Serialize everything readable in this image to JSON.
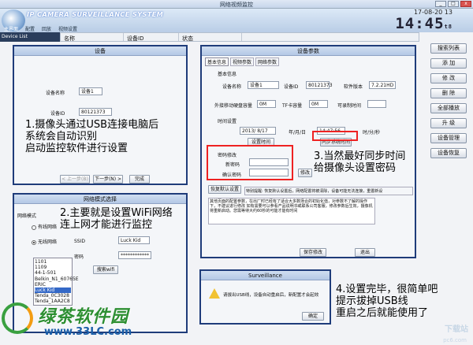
{
  "window": {
    "title": "网络视频监控"
  },
  "header": {
    "system_name": "IP CAMERA SURVEILLANCE SYSTEM",
    "date": "17-08-20 13",
    "time": "14:45",
    "time_suffix": "t8"
  },
  "tabs": [
    "主界面",
    "配置",
    "回放",
    "视频设置"
  ],
  "device_list": {
    "label": "Device List"
  },
  "columns": [
    "名称",
    "设备ID",
    "状态"
  ],
  "right_buttons": [
    "搜索列表",
    "添 加",
    "修 改",
    "删 除",
    "全部播放",
    "升 级",
    "设备管理",
    "设备恢复"
  ],
  "panel_device": {
    "title": "设备",
    "name_label": "设备名称",
    "name_value": "设备1",
    "id_label": "设备ID",
    "id_value": "80121373",
    "prev_button": "< 上一步(B)",
    "next_button": "下一步(N) >",
    "finish_button": "完成"
  },
  "annotations": {
    "step1": [
      "1.摄像头通过USB连接电脑后",
      "系统会自动识别",
      "启动监控软件进行设置"
    ],
    "step2": [
      "2.主要就是设置WiFi网络",
      "连上网才能进行监控"
    ],
    "step3": [
      "3.当然最好同步时间",
      "给摄像头设置密码"
    ],
    "step4": [
      "4.设置完毕，很简单吧",
      "提示拔掉USB线",
      "重启之后就能使用了"
    ]
  },
  "panel_wifi": {
    "title": "网络模式选择",
    "mode_label": "网络模式",
    "wired": "有线网络",
    "wireless": "无线网络",
    "ssid_label": "SSID",
    "ssid_value": "Luck Kid",
    "pwd_label": "密码",
    "pwd_value": "************",
    "search_button": "搜索wifi",
    "ssid_list": [
      "1101",
      "1109",
      "44-1-501",
      "Belkin_N1_60765E",
      "ERIC",
      "Luck Kid",
      "Tenda_0C3028",
      "Tenda_1AA2C8"
    ],
    "selected_ssid": "Luck Kid"
  },
  "panel_params": {
    "title": "设备参数",
    "tabs": [
      "基本信息",
      "视频参数",
      "网络参数"
    ],
    "basic_group": "基本信息",
    "dev_name_label": "设备名称",
    "dev_name_value": "设备1",
    "dev_id_label": "设备ID",
    "dev_id_value": "80121373",
    "fw_label": "软件版本",
    "fw_value": "7.2.21HD",
    "storage_label": "外接移动硬盘容量",
    "storage_value": "0M",
    "tf_label": "TF卡容量",
    "tf_value": "0M",
    "free_label": "可录制时间",
    "free_value": "",
    "time_group": "时间设置",
    "date_value": "2013/ 8/17",
    "ymd_label": "年/月/日",
    "time_value": "14:47:56",
    "hms_label": "时/分/秒",
    "sync_button": "设置时间",
    "sync_pc_button": "同步系统时间",
    "pwd_group": "密码修改",
    "new_pwd_label": "新密码",
    "confirm_pwd_label": "确认密码",
    "modify_button": "修改",
    "restore_button": "恢复默认设置",
    "restore_hint": "特别提醒: 恢复默认设置后，网络配置将被清除，设备可能无法连接，重置新设",
    "note": "其他页面的配置参数，在出厂时已经有了适合大多数场合的初始化值，对参数不了解的操作下，不建议进行修改 如有需要可以参看产品说明书或联系公司客服，修改参数后生效，摄像机将重新启动。您需等待大约60秒的可能才能有时间",
    "save_button": "保存修改",
    "exit_button": "退出"
  },
  "dialog": {
    "title": "Surveillance",
    "message": "请拔出USB线，设备自动重启后，新配置才会起效",
    "ok_button": "确定"
  },
  "brand": {
    "name": "绿茶软件园",
    "url": "www.33LC.com"
  },
  "watermark": {
    "text": "下载站",
    "url": "pc6.com"
  }
}
